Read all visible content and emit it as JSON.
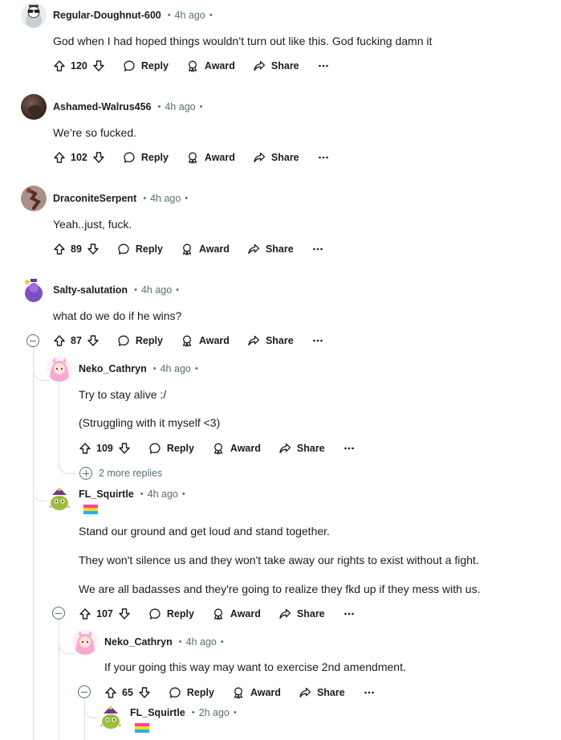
{
  "labels": {
    "reply": "Reply",
    "award": "Award",
    "share": "Share",
    "more": "···",
    "separator": "•"
  },
  "colors": {
    "text": "#1c1c1c",
    "muted": "#576f76",
    "thread_line": "#d9dfe2"
  },
  "comments": [
    {
      "user": "Regular-Doughnut-600",
      "time": "4h ago",
      "lines": [
        "God when I had hoped things wouldn’t turn out like this. God fucking damn it"
      ],
      "score": "120",
      "avatar": "doughnut-avatar"
    },
    {
      "user": "Ashamed-Walrus456",
      "time": "4h ago",
      "lines": [
        "We’re so fucked."
      ],
      "score": "102",
      "avatar": "walrus-avatar"
    },
    {
      "user": "DraconiteSerpent",
      "time": "4h ago",
      "lines": [
        "Yeah..just, fuck."
      ],
      "score": "89",
      "avatar": "serpent-avatar"
    },
    {
      "user": "Salty-salutation",
      "time": "4h ago",
      "lines": [
        "what do we do if he wins?"
      ],
      "score": "87",
      "avatar": "salty-avatar"
    },
    {
      "user": "Neko_Cathryn",
      "time": "4h ago",
      "lines": [
        "Try to stay alive :/",
        "(Struggling with it myself <3)"
      ],
      "score": "109",
      "avatar": "neko-avatar",
      "more_replies": "2 more replies"
    },
    {
      "user": "FL_Squirtle",
      "time": "4h ago",
      "lines": [
        "Stand our ground and get loud and stand together.",
        "They won't silence us and they won't take away our rights to exist without a fight.",
        "We are all badasses and they're going to realize they fkd up if they mess with us."
      ],
      "score": "107",
      "avatar": "squirtle-avatar",
      "flair": "pride-flag-flair"
    },
    {
      "user": "Neko_Cathryn",
      "time": "4h ago",
      "lines": [
        "If your going this way may want to exercise 2nd amendment."
      ],
      "score": "65",
      "avatar": "neko-avatar"
    },
    {
      "user": "FL_Squirtle",
      "time": "2h ago",
      "lines": [],
      "avatar": "squirtle-avatar",
      "flair": "pride-flag-flair"
    }
  ]
}
